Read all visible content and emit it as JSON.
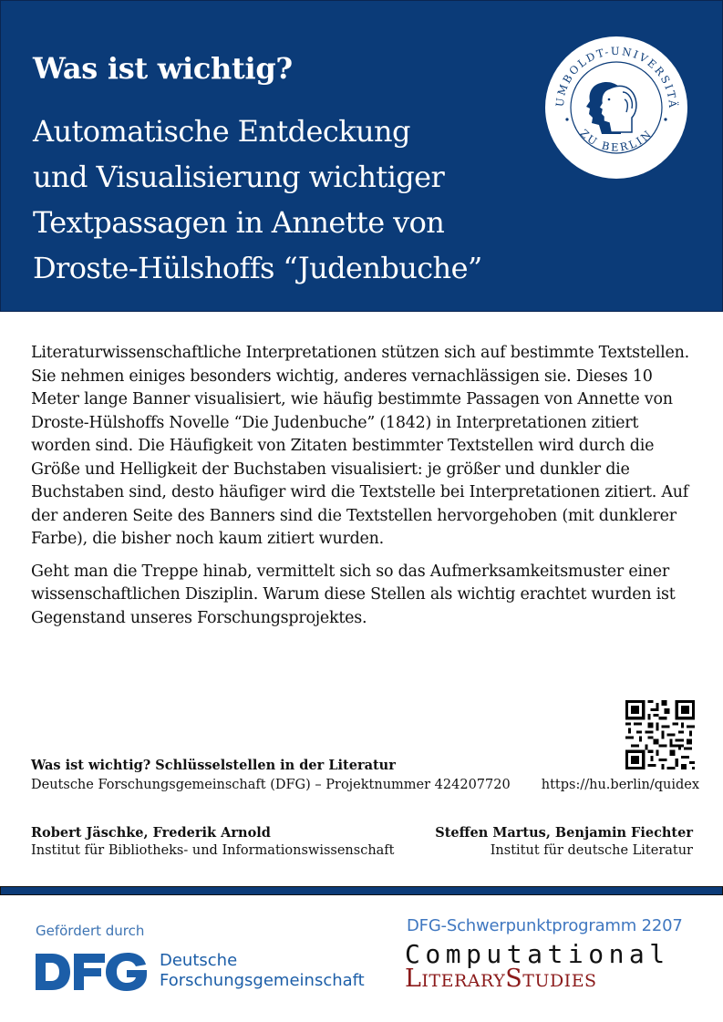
{
  "header": {
    "title": "Was ist wichtig?",
    "subtitle_lines": [
      "Automatische Entdeckung",
      "und Visualisierung wichtiger",
      "Textpassagen in Annette von",
      "Droste-Hülshoffs “Judenbuche”"
    ],
    "seal": {
      "top_text": "HUMBOLDT-UNIVERSITÄT",
      "bottom_text": "ZU BERLIN"
    }
  },
  "body": {
    "paragraph1": "Literaturwissenschaftliche Interpretationen stützen sich auf bestimmte Textstellen. Sie nehmen einiges besonders wichtig, anderes vernachlässigen sie. Dieses 10 Meter lange Banner visualisiert, wie häufig bestimmte Passagen von Annette von Droste-Hülshoffs Novelle “Die Judenbuche” (1842) in Interpretationen zitiert worden sind. Die Häufigkeit von Zitaten bestimmter Textstellen wird durch die Größe und Helligkeit der Buchstaben visualisiert: je größer und dunkler die Buchstaben sind, desto häufiger wird die Textstelle bei Interpretationen zitiert. Auf der anderen Seite des Banners sind die Textstellen hervorgehoben (mit dunklerer Farbe), die bisher noch kaum zitiert wurden.",
    "paragraph2": "Geht man die Treppe hinab, vermittelt sich so das Aufmerksamkeitsmuster einer wissenschaftlichen Disziplin. Warum diese Stellen als wichtig erachtet wurden ist Gegenstand unseres Forschungsprojektes."
  },
  "project": {
    "title": "Was ist wichtig? Schlüsselstellen in der Literatur",
    "funding_line": "Deutsche Forschungsgemeinschaft (DFG) – Projektnummer 424207720",
    "url": "https://hu.berlin/quidex"
  },
  "authors": {
    "left_names": "Robert Jäschke, Frederik Arnold",
    "left_institute": "Institut für Bibliotheks- und Informationswissenschaft",
    "right_names": "Steffen Martus, Benjamin Fiechter",
    "right_institute": "Institut für deutsche Literatur"
  },
  "footer": {
    "funded_by": "Gefördert durch",
    "dfg_name_line1": "Deutsche",
    "dfg_name_line2": "Forschungsgemeinschaft",
    "spp": "DFG-Schwerpunktprogramm 2207",
    "cls_line1": "Computational",
    "cls_line2": "LiteraryStudies"
  },
  "colors": {
    "header_blue": "#0b3b78",
    "dfg_blue": "#1c5ea8",
    "cls_red": "#8b1a1a"
  }
}
